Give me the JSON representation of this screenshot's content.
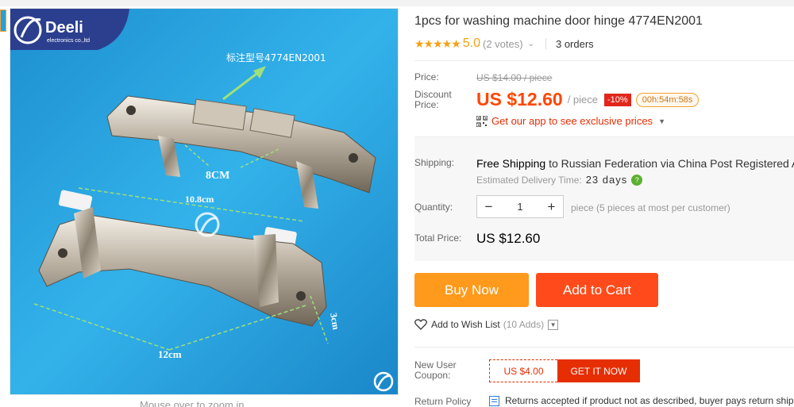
{
  "product": {
    "title": "1pcs for washing machine door hinge 4774EN2001",
    "stars": "★★★★★",
    "rating": "5.0",
    "votes": "(2 votes)",
    "orders": "3 orders"
  },
  "image": {
    "logo_text": "Deeli",
    "logo_sub": "electronics co.,ltd",
    "model_label": "标注型号4774EN2001",
    "dim_8": "8CM",
    "dim_108": "10.8cm",
    "dim_3": "3cm",
    "dim_12": "12cm",
    "zoom_hint": "Mouse over to zoom in"
  },
  "price": {
    "label": "Price:",
    "original": "US $14.00 / piece",
    "discount_label_1": "Discount",
    "discount_label_2": "Price:",
    "discount_price": "US $12.60",
    "per_piece": "/ piece",
    "discount_badge": "-10%",
    "timer": "00h:54m:58s",
    "app_promo": "Get our app to see exclusive prices"
  },
  "shipping": {
    "label": "Shipping:",
    "free": "Free Shipping",
    "to": "to Russian Federation via China Post Registered Air Mail",
    "est_label": "Estimated Delivery Time:",
    "est_days": "23 days"
  },
  "quantity": {
    "label": "Quantity:",
    "minus": "−",
    "value": "1",
    "plus": "+",
    "note": "piece (5 pieces at most per customer)"
  },
  "total": {
    "label": "Total Price:",
    "value": "US $12.60"
  },
  "actions": {
    "buy_now": "Buy Now",
    "add_to_cart": "Add to Cart",
    "wishlist": "Add to Wish List",
    "wish_count": "(10 Adds)"
  },
  "coupon": {
    "label_1": "New User",
    "label_2": "Coupon:",
    "value": "US $4.00",
    "cta": "GET IT NOW"
  },
  "returns": {
    "label": "Return Policy",
    "text": "Returns accepted if product not as described, buyer pays return shipping"
  },
  "colors": {
    "accent_orange": "#ff9a1c",
    "cart_red": "#ff4b1b",
    "price_red": "#ff4700",
    "star_yellow": "#f7a012",
    "image_bg": "#23a0de"
  }
}
